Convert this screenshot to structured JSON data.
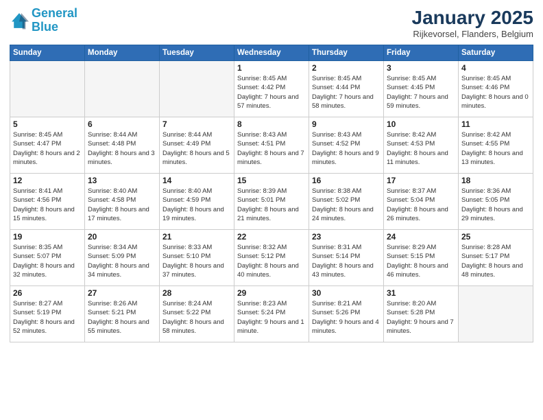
{
  "header": {
    "logo_line1": "General",
    "logo_line2": "Blue",
    "month": "January 2025",
    "location": "Rijkevorsel, Flanders, Belgium"
  },
  "days_of_week": [
    "Sunday",
    "Monday",
    "Tuesday",
    "Wednesday",
    "Thursday",
    "Friday",
    "Saturday"
  ],
  "weeks": [
    [
      {
        "day": "",
        "empty": true
      },
      {
        "day": "",
        "empty": true
      },
      {
        "day": "",
        "empty": true
      },
      {
        "day": "1",
        "sunrise": "8:45 AM",
        "sunset": "4:42 PM",
        "daylight": "7 hours and 57 minutes."
      },
      {
        "day": "2",
        "sunrise": "8:45 AM",
        "sunset": "4:44 PM",
        "daylight": "7 hours and 58 minutes."
      },
      {
        "day": "3",
        "sunrise": "8:45 AM",
        "sunset": "4:45 PM",
        "daylight": "7 hours and 59 minutes."
      },
      {
        "day": "4",
        "sunrise": "8:45 AM",
        "sunset": "4:46 PM",
        "daylight": "8 hours and 0 minutes."
      }
    ],
    [
      {
        "day": "5",
        "sunrise": "8:45 AM",
        "sunset": "4:47 PM",
        "daylight": "8 hours and 2 minutes."
      },
      {
        "day": "6",
        "sunrise": "8:44 AM",
        "sunset": "4:48 PM",
        "daylight": "8 hours and 3 minutes."
      },
      {
        "day": "7",
        "sunrise": "8:44 AM",
        "sunset": "4:49 PM",
        "daylight": "8 hours and 5 minutes."
      },
      {
        "day": "8",
        "sunrise": "8:43 AM",
        "sunset": "4:51 PM",
        "daylight": "8 hours and 7 minutes."
      },
      {
        "day": "9",
        "sunrise": "8:43 AM",
        "sunset": "4:52 PM",
        "daylight": "8 hours and 9 minutes."
      },
      {
        "day": "10",
        "sunrise": "8:42 AM",
        "sunset": "4:53 PM",
        "daylight": "8 hours and 11 minutes."
      },
      {
        "day": "11",
        "sunrise": "8:42 AM",
        "sunset": "4:55 PM",
        "daylight": "8 hours and 13 minutes."
      }
    ],
    [
      {
        "day": "12",
        "sunrise": "8:41 AM",
        "sunset": "4:56 PM",
        "daylight": "8 hours and 15 minutes."
      },
      {
        "day": "13",
        "sunrise": "8:40 AM",
        "sunset": "4:58 PM",
        "daylight": "8 hours and 17 minutes."
      },
      {
        "day": "14",
        "sunrise": "8:40 AM",
        "sunset": "4:59 PM",
        "daylight": "8 hours and 19 minutes."
      },
      {
        "day": "15",
        "sunrise": "8:39 AM",
        "sunset": "5:01 PM",
        "daylight": "8 hours and 21 minutes."
      },
      {
        "day": "16",
        "sunrise": "8:38 AM",
        "sunset": "5:02 PM",
        "daylight": "8 hours and 24 minutes."
      },
      {
        "day": "17",
        "sunrise": "8:37 AM",
        "sunset": "5:04 PM",
        "daylight": "8 hours and 26 minutes."
      },
      {
        "day": "18",
        "sunrise": "8:36 AM",
        "sunset": "5:05 PM",
        "daylight": "8 hours and 29 minutes."
      }
    ],
    [
      {
        "day": "19",
        "sunrise": "8:35 AM",
        "sunset": "5:07 PM",
        "daylight": "8 hours and 32 minutes."
      },
      {
        "day": "20",
        "sunrise": "8:34 AM",
        "sunset": "5:09 PM",
        "daylight": "8 hours and 34 minutes."
      },
      {
        "day": "21",
        "sunrise": "8:33 AM",
        "sunset": "5:10 PM",
        "daylight": "8 hours and 37 minutes."
      },
      {
        "day": "22",
        "sunrise": "8:32 AM",
        "sunset": "5:12 PM",
        "daylight": "8 hours and 40 minutes."
      },
      {
        "day": "23",
        "sunrise": "8:31 AM",
        "sunset": "5:14 PM",
        "daylight": "8 hours and 43 minutes."
      },
      {
        "day": "24",
        "sunrise": "8:29 AM",
        "sunset": "5:15 PM",
        "daylight": "8 hours and 46 minutes."
      },
      {
        "day": "25",
        "sunrise": "8:28 AM",
        "sunset": "5:17 PM",
        "daylight": "8 hours and 48 minutes."
      }
    ],
    [
      {
        "day": "26",
        "sunrise": "8:27 AM",
        "sunset": "5:19 PM",
        "daylight": "8 hours and 52 minutes."
      },
      {
        "day": "27",
        "sunrise": "8:26 AM",
        "sunset": "5:21 PM",
        "daylight": "8 hours and 55 minutes."
      },
      {
        "day": "28",
        "sunrise": "8:24 AM",
        "sunset": "5:22 PM",
        "daylight": "8 hours and 58 minutes."
      },
      {
        "day": "29",
        "sunrise": "8:23 AM",
        "sunset": "5:24 PM",
        "daylight": "9 hours and 1 minute."
      },
      {
        "day": "30",
        "sunrise": "8:21 AM",
        "sunset": "5:26 PM",
        "daylight": "9 hours and 4 minutes."
      },
      {
        "day": "31",
        "sunrise": "8:20 AM",
        "sunset": "5:28 PM",
        "daylight": "9 hours and 7 minutes."
      },
      {
        "day": "",
        "empty": true
      }
    ]
  ],
  "labels": {
    "sunrise": "Sunrise:",
    "sunset": "Sunset:",
    "daylight": "Daylight:"
  }
}
